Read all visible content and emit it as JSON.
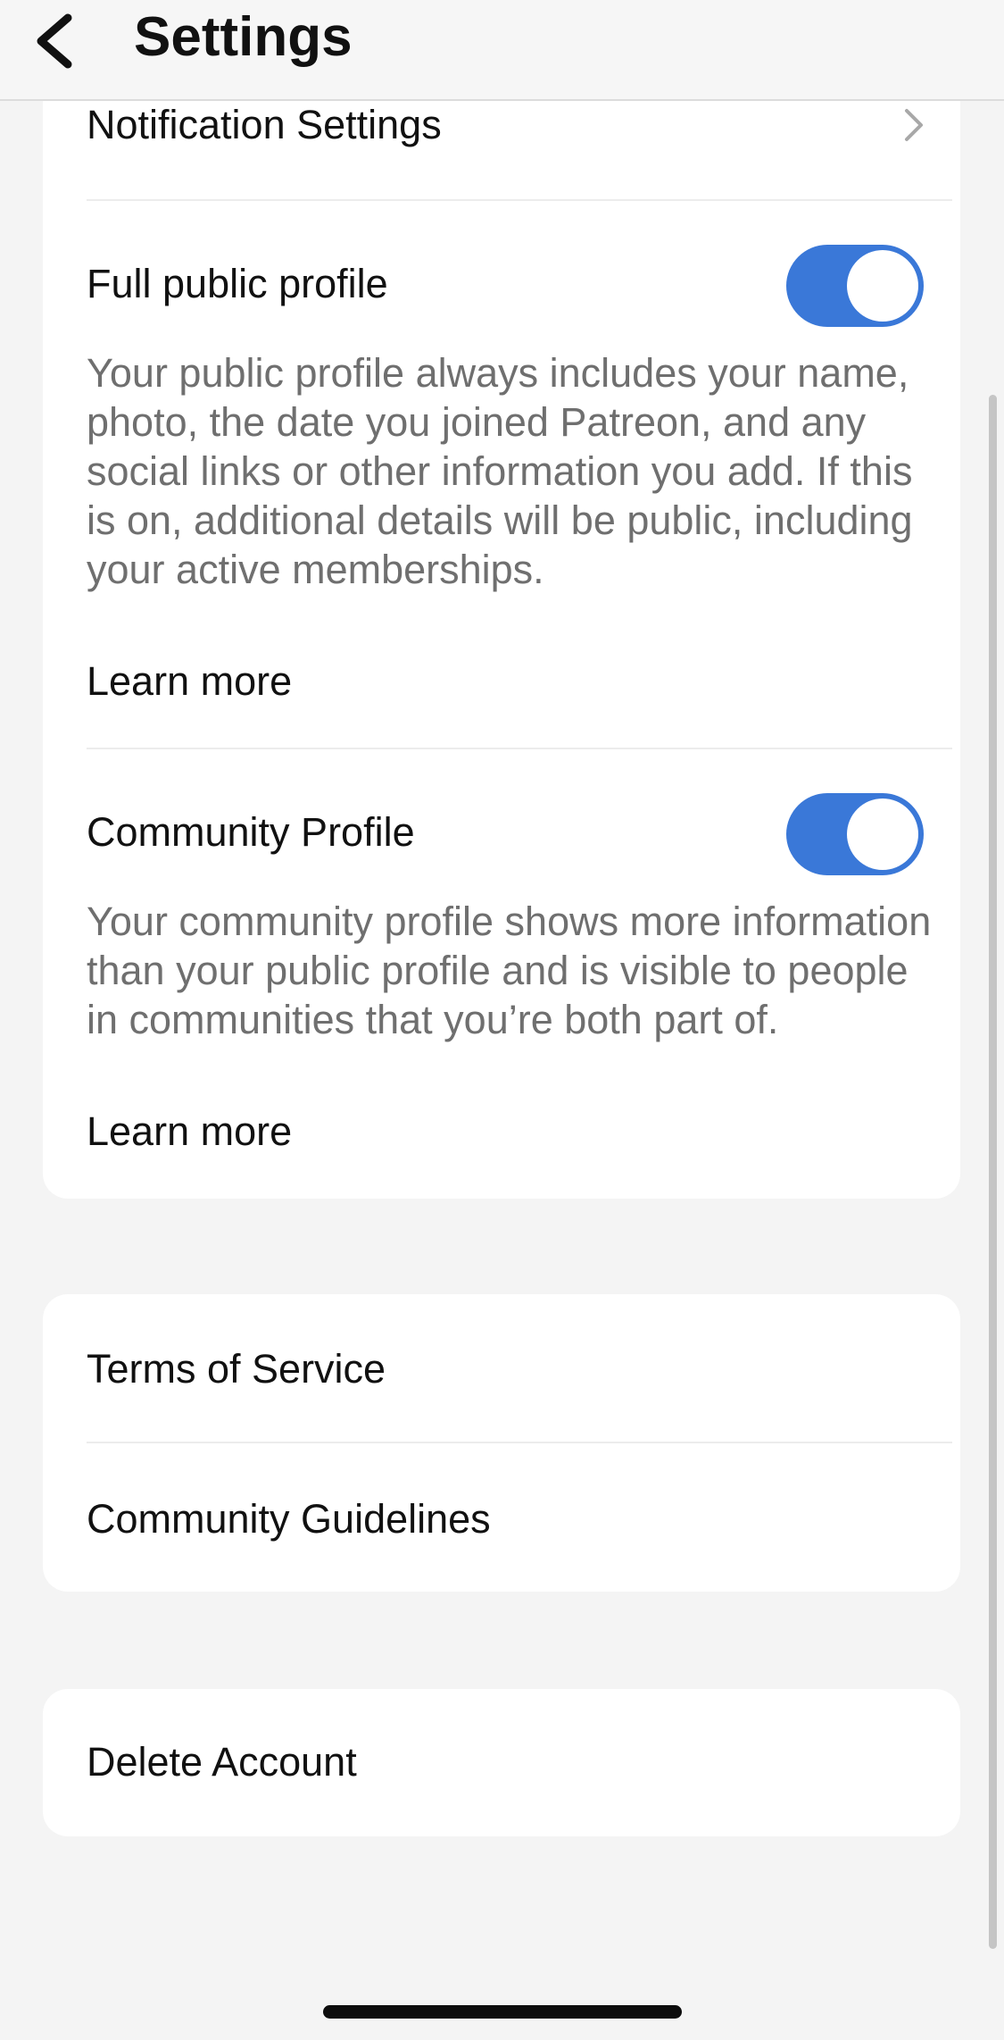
{
  "header": {
    "title": "Settings",
    "back_icon": "chevron-left-icon"
  },
  "privacy_section": {
    "notification_settings": {
      "label": "Notification Settings",
      "icon": "chevron-right-icon"
    },
    "full_public_profile": {
      "label": "Full public profile",
      "enabled": true,
      "description": "Your public profile always includes your name, photo, the date you joined Patreon, and any social links or other information you add. If this is on, additional details will be public, including your active memberships.",
      "learn_more": "Learn more"
    },
    "community_profile": {
      "label": "Community Profile",
      "enabled": true,
      "description": "Your community profile shows more information than your public profile and is visible to people in communities that you’re both part of.",
      "learn_more": "Learn more"
    }
  },
  "legal_section": {
    "terms": "Terms of Service",
    "guidelines": "Community Guidelines"
  },
  "account_section": {
    "delete_account": "Delete Account"
  },
  "colors": {
    "toggle_on": "#3a78d8",
    "background": "#f4f4f4",
    "card": "#ffffff",
    "secondary_text": "#6f6f6f"
  }
}
